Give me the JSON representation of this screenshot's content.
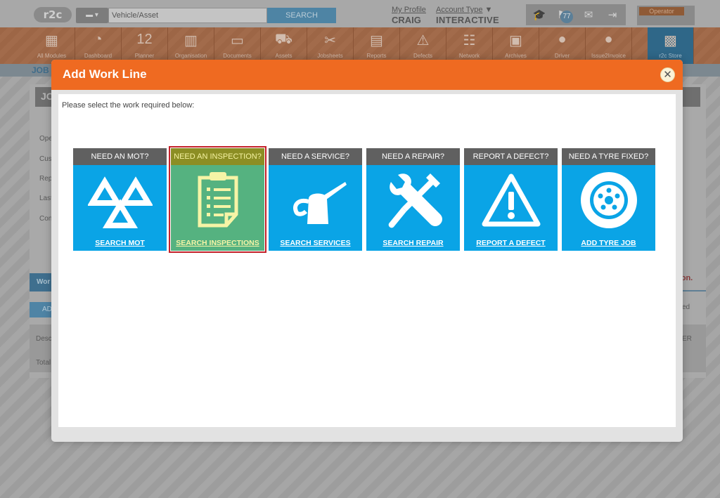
{
  "header": {
    "logo_text": "r2c",
    "search": {
      "placeholder": "Vehicle/Asset",
      "button_label": "SEARCH"
    },
    "profile": {
      "link": "My Profile",
      "name": "CRAIG"
    },
    "account": {
      "link": "Account Type",
      "type": "INTERACTIVE"
    },
    "notifications_count": "77",
    "operator_label": "Operator"
  },
  "modules": [
    {
      "label": "All Modules",
      "icon": "grid-icon"
    },
    {
      "label": "Dashboard",
      "icon": "gauge-icon"
    },
    {
      "label": "Planner",
      "icon": "calendar-icon",
      "day": "12"
    },
    {
      "label": "Organisation",
      "icon": "building-icon"
    },
    {
      "label": "Documents",
      "icon": "folder-icon"
    },
    {
      "label": "Assets",
      "icon": "truck-icon"
    },
    {
      "label": "Jobsheets",
      "icon": "tools-icon"
    },
    {
      "label": "Reports",
      "icon": "clipboard-icon"
    },
    {
      "label": "Defects",
      "icon": "warning-icon"
    },
    {
      "label": "Network",
      "icon": "contacts-icon"
    },
    {
      "label": "Archives",
      "icon": "archive-icon"
    },
    {
      "label": "Driver",
      "icon": "driver-icon"
    },
    {
      "label": "Issue2Invoice",
      "icon": "i2i-icon"
    },
    {
      "label": "r2c Store",
      "icon": "briefcase-icon"
    }
  ],
  "page": {
    "subbar_label": "JOB",
    "title": "JO",
    "side_labels": [
      "Ope",
      "Cus",
      "Rep",
      "Last",
      "Con"
    ],
    "tab_label": "Wor",
    "add_label": "AD",
    "red_text": "tion.",
    "right_text": "ed",
    "right_col": "ER",
    "table_rows": [
      "Desc",
      "Total"
    ]
  },
  "modal": {
    "title": "Add Work Line",
    "close_symbol": "✕",
    "intro": "Please select the work required below:",
    "tiles": [
      {
        "header": "NEED AN MOT?",
        "link": "SEARCH MOT",
        "icon": "mot-triangles-icon"
      },
      {
        "header": "NEED AN INSPECTION?",
        "link": "SEARCH INSPECTIONS",
        "icon": "clipboard-icon",
        "selected": true
      },
      {
        "header": "NEED A SERVICE?",
        "link": "SEARCH SERVICES",
        "icon": "oil-can-icon"
      },
      {
        "header": "NEED A REPAIR?",
        "link": "SEARCH REPAIR",
        "icon": "wrench-screwdriver-icon"
      },
      {
        "header": "REPORT A DEFECT?",
        "link": "REPORT A DEFECT",
        "icon": "warning-icon"
      },
      {
        "header": "NEED A TYRE FIXED?",
        "link": "ADD TYRE JOB",
        "icon": "tyre-icon"
      }
    ]
  },
  "colors": {
    "modal_header": "#ef6a21",
    "tile_blue": "#0aa4e6",
    "tile_header": "#606060",
    "selected_green": "#55b280",
    "selected_outline": "#c4212a"
  }
}
